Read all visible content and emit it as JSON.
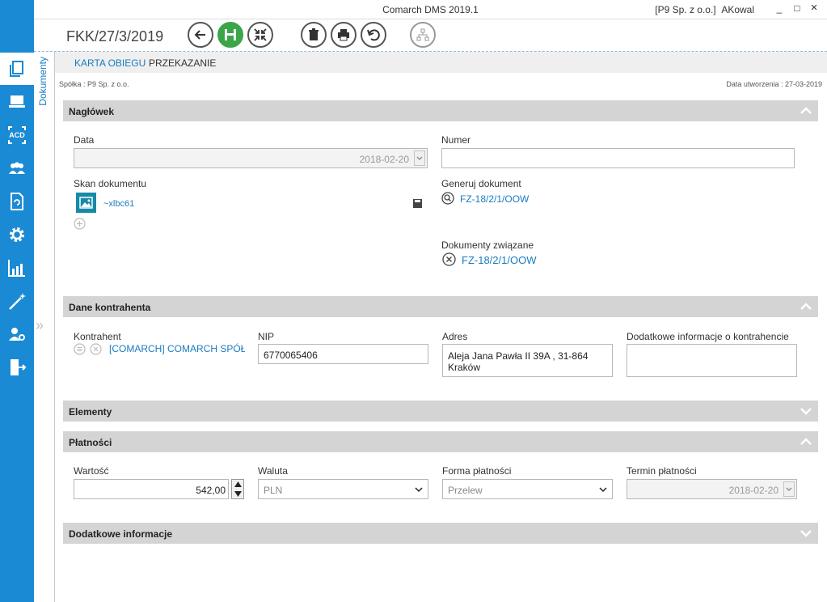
{
  "window": {
    "title": "Comarch DMS 2019.1",
    "company": "[P9 Sp. z o.o.]",
    "user": "AKowal",
    "minimize": "_",
    "maximize": "□",
    "close": "×"
  },
  "sidebar": {
    "vertical_tab": "Dokumenty",
    "items": [
      "documents-icon",
      "laptop-icon",
      "acd-icon",
      "users-icon",
      "document-refresh-icon",
      "gear-icon",
      "chart-icon",
      "magic-wand-icon",
      "user-settings-icon",
      "exit-icon"
    ],
    "acd_label": "ACD",
    "expand_arrow": "»"
  },
  "toolbar": {
    "doc_number": "FKK/27/3/2019"
  },
  "tabs": [
    {
      "label": "KARTA OBIEGU",
      "active": true
    },
    {
      "label": "PRZEKAZANIE",
      "active": false
    }
  ],
  "meta": {
    "company": "Spółka : P9 Sp. z o.o.",
    "created": "Data utworzenia : 27-03-2019"
  },
  "naglowek": {
    "title": "Nagłówek",
    "data_label": "Data",
    "data_value": "2018-02-20",
    "numer_label": "Numer",
    "numer_value": "",
    "skan_label": "Skan dokumentu",
    "skan_file": "~xlbc61",
    "generuj_label": "Generuj dokument",
    "generuj_link": "FZ-18/2/1/OOW",
    "zwiazane_label": "Dokumenty związane",
    "zwiazane_link": "FZ-18/2/1/OOW"
  },
  "kontrahent": {
    "title": "Dane kontrahenta",
    "kontrahent_label": "Kontrahent",
    "kontrahent_value": "[COMARCH] COMARCH SPÓŁKA AKC",
    "nip_label": "NIP",
    "nip_value": "6770065406",
    "adres_label": "Adres",
    "adres_value": "Aleja Jana Pawła II 39A , 31-864 Kraków",
    "dodatkowe_label": "Dodatkowe informacje o kontrahencie",
    "dodatkowe_value": ""
  },
  "elementy": {
    "title": "Elementy"
  },
  "platnosci": {
    "title": "Płatności",
    "wartosc_label": "Wartość",
    "wartosc_value": "542,00",
    "waluta_label": "Waluta",
    "waluta_value": "PLN",
    "forma_label": "Forma płatności",
    "forma_value": "Przelew",
    "termin_label": "Termin płatności",
    "termin_value": "2018-02-20"
  },
  "dodatkowe": {
    "title": "Dodatkowe informacje"
  },
  "colors": {
    "sidebar": "#1a8ad4",
    "link": "#1a7bbf",
    "save": "#3aa648",
    "section": "#d4d4d4"
  }
}
